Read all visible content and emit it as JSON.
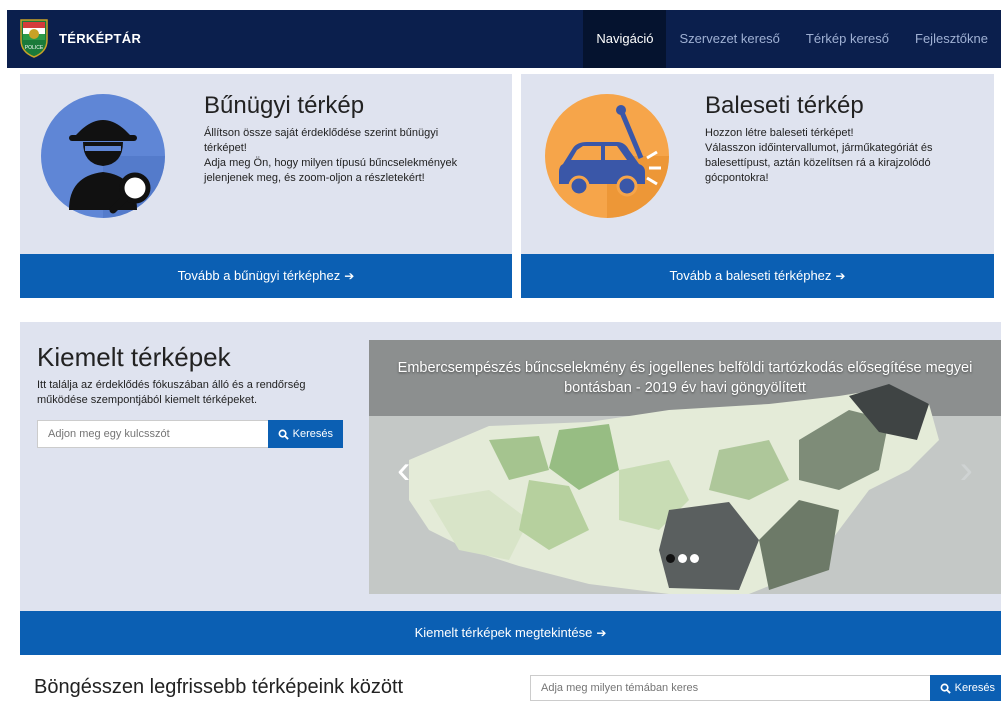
{
  "header": {
    "brand": "TÉRKÉPTÁR",
    "logo_text": "POLICE",
    "nav": [
      {
        "label": "Navigáció",
        "active": true
      },
      {
        "label": "Szervezet kereső",
        "active": false
      },
      {
        "label": "Térkép kereső",
        "active": false
      },
      {
        "label": "Fejlesztőkne",
        "active": false
      }
    ]
  },
  "crime_card": {
    "title": "Bűnügyi térkép",
    "text": "Állítson össze saját érdeklődése szerint bűnügyi\ntérképet!\nAdja meg Ön, hogy milyen típusú bűncselekmények\njelenjenek meg, és zoom-oljon a részletekért!",
    "button": "Tovább a bűnügyi térképhez",
    "icon": "detective-icon"
  },
  "accident_card": {
    "title": "Baleseti térkép",
    "text": "Hozzon létre baleseti térképet!\nVálasszon időintervallumot, járműkategóriát és\nbalesettípust, aztán közelítsen rá a kirajzolódó\ngócpontokra!",
    "button": "Tovább a baleseti térképhez",
    "icon": "car-crash-icon"
  },
  "featured": {
    "title": "Kiemelt térképek",
    "description": "Itt találja az érdeklődés fókuszában álló és a rendőrség működése szempontjából kiemelt térképeket.",
    "search_placeholder": "Adjon meg egy kulcsszót",
    "search_button": "Keresés",
    "carousel_caption": "Embercsempészés bűncselekmény és jogellenes belföldi tartózkodás elősegítése megyei bontásban - 2019 év havi göngyölített",
    "view_button": "Kiemelt térképek megtekintése",
    "slide_count": 3,
    "active_slide": 1
  },
  "browse": {
    "title": "Böngésszen legfrissebb térképeink között",
    "search_placeholder": "Adja meg milyen témában keres",
    "search_button": "Keresés"
  },
  "colors": {
    "navbar": "#0b1f4d",
    "accent": "#0b5fb3",
    "card_bg": "#dfe3ef"
  }
}
